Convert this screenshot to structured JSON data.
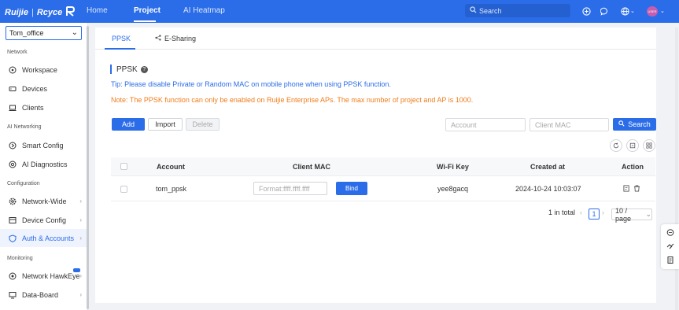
{
  "topbar": {
    "brand": "Ruijie",
    "brand_sub": "Rcyce",
    "nav": [
      "Home",
      "Project",
      "AI Heatmap"
    ],
    "active_nav": "Project",
    "search_placeholder": "Search",
    "avatar_text": "USER"
  },
  "sidebar": {
    "site": "Tom_office",
    "sections": [
      {
        "title": "Network",
        "items": [
          "Workspace",
          "Devices",
          "Clients"
        ]
      },
      {
        "title": "AI Networking",
        "items": [
          "Smart Config",
          "AI Diagnostics"
        ]
      },
      {
        "title": "Configuration",
        "items": [
          "Network-Wide",
          "Device Config",
          "Auth & Accounts"
        ]
      },
      {
        "title": "Monitoring",
        "items": [
          "Network HawkEye",
          "Data-Board"
        ]
      }
    ],
    "active_item": "Auth & Accounts"
  },
  "tabs": [
    "PPSK",
    "E-Sharing"
  ],
  "content": {
    "title": "PPSK",
    "tip": "Tip: Please disable Private or Random MAC on mobile phone when using PPSK function.",
    "note": "Note: The PPSK function can only be enabled on Ruijie Enterprise APs. The max number of project and AP is 1000.",
    "buttons": {
      "add": "Add",
      "import": "Import",
      "delete": "Delete",
      "search": "Search"
    },
    "filters": {
      "account_placeholder": "Account",
      "mac_placeholder": "Client MAC"
    },
    "columns": [
      "Account",
      "Client MAC",
      "Wi-Fi Key",
      "Created at",
      "Action"
    ],
    "rows": [
      {
        "account": "tom_ppsk",
        "mac_placeholder": "Format:ffff.ffff.ffff",
        "bind": "Bind",
        "wifi_key": "yee8gacq",
        "created_at": "2024-10-24 10:03:07"
      }
    ],
    "pagination": {
      "total": "1 in total",
      "page": "1",
      "page_size": "10 / page"
    }
  },
  "colors": {
    "primary": "#2b6de8",
    "warning": "#f07c1a",
    "topbar": "#2b6de8"
  }
}
